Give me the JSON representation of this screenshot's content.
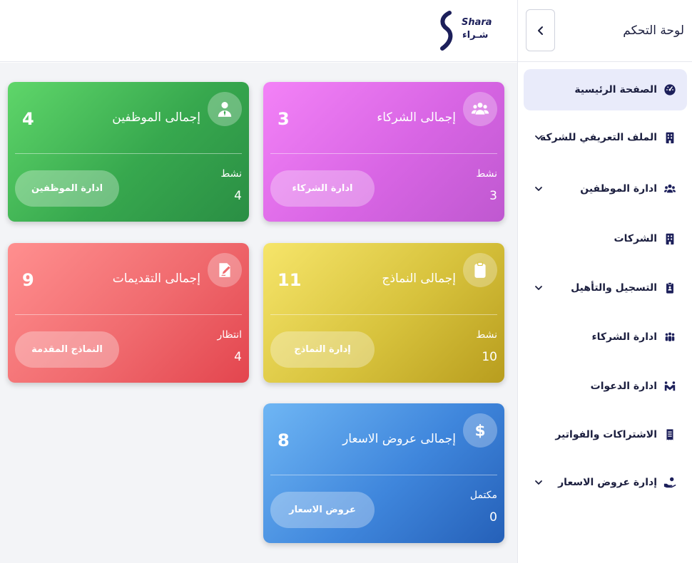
{
  "brand": {
    "name_en": "Shara",
    "name_ar": "شـراء"
  },
  "sidebar": {
    "title": "لوحة التحكم",
    "items": [
      {
        "label": "الصفحة الرئيسية",
        "icon": "dashboard-icon",
        "active": true,
        "expandable": false
      },
      {
        "label": "الملف التعريفي للشركة",
        "icon": "building-icon",
        "active": false,
        "expandable": true
      },
      {
        "label": "ادارة الموظفين",
        "icon": "users-icon",
        "active": false,
        "expandable": true
      },
      {
        "label": "الشركات",
        "icon": "building-icon",
        "active": false,
        "expandable": false
      },
      {
        "label": "التسجيل والتأهيل",
        "icon": "clipboard-icon",
        "active": false,
        "expandable": true
      },
      {
        "label": "ادارة الشركاء",
        "icon": "people-group-icon",
        "active": false,
        "expandable": false
      },
      {
        "label": "ادارة الدعوات",
        "icon": "handshake-icon",
        "active": false,
        "expandable": false
      },
      {
        "label": "الاشتراكات والفواتير",
        "icon": "receipt-icon",
        "active": false,
        "expandable": false
      },
      {
        "label": "إدارة عروض الاسعار",
        "icon": "hand-money-icon",
        "active": false,
        "expandable": true
      }
    ]
  },
  "cards": {
    "partners": {
      "title": "إجمالى الشركاء",
      "count": "3",
      "sub_label": "نشط",
      "sub_value": "3",
      "button": "ادارة الشركاء",
      "icon": "users-group-icon"
    },
    "employees": {
      "title": "إجمالى الموظفين",
      "count": "4",
      "sub_label": "نشط",
      "sub_value": "4",
      "button": "ادارة الموظفين",
      "icon": "employee-icon"
    },
    "forms": {
      "title": "إجمالى النماذج",
      "count": "11",
      "sub_label": "نشط",
      "sub_value": "10",
      "button": "إدارة النماذج",
      "icon": "clipboard-icon"
    },
    "submissions": {
      "title": "إجمالى التقديمات",
      "count": "9",
      "sub_label": "انتظار",
      "sub_value": "4",
      "button": "النماذج المقدمة",
      "icon": "document-edit-icon"
    },
    "quotes": {
      "title": "إجمالى عروض الاسعار",
      "count": "8",
      "sub_label": "مكتمل",
      "sub_value": "0",
      "button": "عروض الاسعار",
      "icon": "dollar-icon"
    }
  },
  "colors": {
    "primary": "#1c1f5a",
    "active_bg": "#e9ebfa",
    "green": "#37a84e",
    "pink": "#d865e4",
    "red": "#f06a6e",
    "yellow": "#d7c23c",
    "blue": "#3f86dc"
  }
}
